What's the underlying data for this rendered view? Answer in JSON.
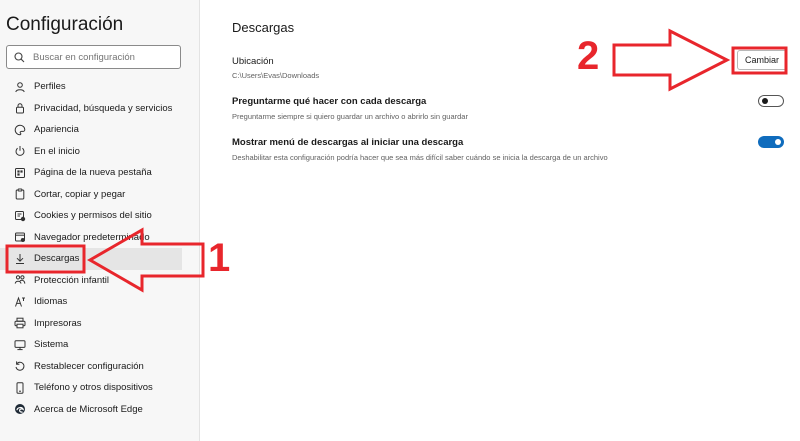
{
  "sidebar": {
    "title": "Configuración",
    "search_placeholder": "Buscar en configuración",
    "items": [
      {
        "label": "Perfiles",
        "icon": "profile-icon"
      },
      {
        "label": "Privacidad, búsqueda y servicios",
        "icon": "lock-icon"
      },
      {
        "label": "Apariencia",
        "icon": "palette-icon"
      },
      {
        "label": "En el inicio",
        "icon": "power-icon"
      },
      {
        "label": "Página de la nueva pestaña",
        "icon": "new-tab-icon"
      },
      {
        "label": "Cortar, copiar y pegar",
        "icon": "clipboard-icon"
      },
      {
        "label": "Cookies y permisos del sitio",
        "icon": "cookies-icon"
      },
      {
        "label": "Navegador predeterminado",
        "icon": "browser-icon"
      },
      {
        "label": "Descargas",
        "icon": "download-icon",
        "active": true
      },
      {
        "label": "Protección infantil",
        "icon": "family-icon"
      },
      {
        "label": "Idiomas",
        "icon": "language-icon"
      },
      {
        "label": "Impresoras",
        "icon": "printer-icon"
      },
      {
        "label": "Sistema",
        "icon": "system-icon"
      },
      {
        "label": "Restablecer configuración",
        "icon": "reset-icon"
      },
      {
        "label": "Teléfono y otros dispositivos",
        "icon": "phone-icon"
      },
      {
        "label": "Acerca de Microsoft Edge",
        "icon": "edge-icon"
      }
    ]
  },
  "main": {
    "title": "Descargas",
    "location": {
      "label": "Ubicación",
      "path": "C:\\Users\\Evas\\Downloads",
      "button": "Cambiar"
    },
    "ask": {
      "label": "Preguntarme qué hacer con cada descarga",
      "description": "Preguntarme siempre si quiero guardar un archivo o abrirlo sin guardar",
      "enabled": false
    },
    "menu": {
      "label": "Mostrar menú de descargas al iniciar una descarga",
      "description": "Deshabilitar esta configuración podría hacer que sea más difícil saber cuándo se inicia la descarga de un archivo",
      "enabled": true
    }
  },
  "annotations": {
    "step1": "1",
    "step2": "2",
    "color": "#e8262c"
  },
  "colors": {
    "accent": "#0f6cbd",
    "annotation": "#e8262c"
  }
}
